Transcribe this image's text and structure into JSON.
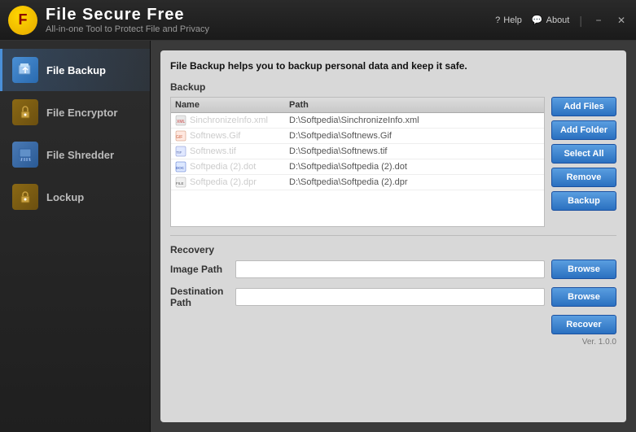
{
  "titleBar": {
    "logo": "F",
    "appName": "File Secure Free",
    "subtitle": "All-in-one Tool to Protect File and Privacy",
    "helpLabel": "Help",
    "aboutLabel": "About",
    "minimizeLabel": "−",
    "closeLabel": "✕"
  },
  "sidebar": {
    "items": [
      {
        "id": "file-backup",
        "label": "File Backup",
        "active": true
      },
      {
        "id": "file-encryptor",
        "label": "File Encryptor",
        "active": false
      },
      {
        "id": "file-shredder",
        "label": "File Shredder",
        "active": false
      },
      {
        "id": "lockup",
        "label": "Lockup",
        "active": false
      }
    ]
  },
  "content": {
    "description": "File Backup helps you to backup personal data and keep it safe.",
    "backup": {
      "sectionLabel": "Backup",
      "columns": [
        "Name",
        "Path"
      ],
      "files": [
        {
          "name": "SinchronizeInfo.xml",
          "path": "D:\\Softpedia\\SinchronizeInfo.xml",
          "iconType": "xml"
        },
        {
          "name": "Softnews.Gif",
          "path": "D:\\Softpedia\\Softnews.Gif",
          "iconType": "gif"
        },
        {
          "name": "Softnews.tif",
          "path": "D:\\Softpedia\\Softnews.tif",
          "iconType": "tif"
        },
        {
          "name": "Softpedia (2).dot",
          "path": "D:\\Softpedia\\Softpedia (2).dot",
          "iconType": "doc"
        },
        {
          "name": "Softpedia (2).dpr",
          "path": "D:\\Softpedia\\Softpedia (2).dpr",
          "iconType": "file"
        }
      ],
      "buttons": [
        "Add Files",
        "Add Folder",
        "Select All",
        "Remove",
        "Backup"
      ]
    },
    "recovery": {
      "sectionLabel": "Recovery",
      "imagePath": {
        "label": "Image Path",
        "value": "",
        "placeholder": ""
      },
      "destinationPath": {
        "label": "Destination Path",
        "value": "",
        "placeholder": ""
      },
      "browseLabel": "Browse",
      "recoverLabel": "Recover"
    },
    "version": "Ver. 1.0.0"
  }
}
